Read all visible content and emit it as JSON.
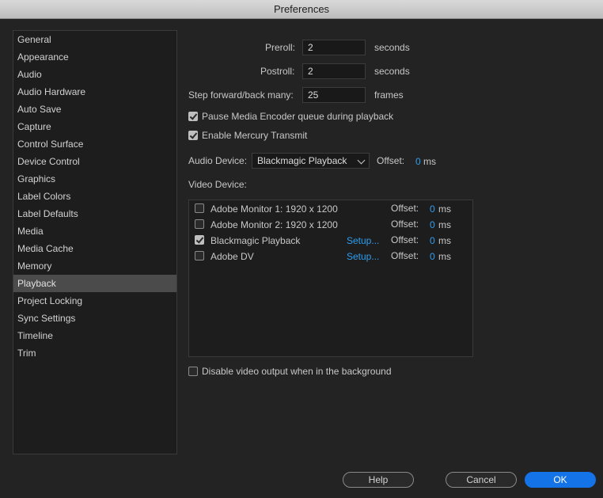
{
  "window": {
    "title": "Preferences"
  },
  "sidebar": {
    "items": [
      {
        "label": "General"
      },
      {
        "label": "Appearance"
      },
      {
        "label": "Audio"
      },
      {
        "label": "Audio Hardware"
      },
      {
        "label": "Auto Save"
      },
      {
        "label": "Capture"
      },
      {
        "label": "Control Surface"
      },
      {
        "label": "Device Control"
      },
      {
        "label": "Graphics"
      },
      {
        "label": "Label Colors"
      },
      {
        "label": "Label Defaults"
      },
      {
        "label": "Media"
      },
      {
        "label": "Media Cache"
      },
      {
        "label": "Memory"
      },
      {
        "label": "Playback"
      },
      {
        "label": "Project Locking"
      },
      {
        "label": "Sync Settings"
      },
      {
        "label": "Timeline"
      },
      {
        "label": "Trim"
      }
    ],
    "selected": "Playback"
  },
  "playback": {
    "preroll": {
      "label": "Preroll:",
      "value": "2",
      "unit": "seconds"
    },
    "postroll": {
      "label": "Postroll:",
      "value": "2",
      "unit": "seconds"
    },
    "step": {
      "label": "Step forward/back many:",
      "value": "25",
      "unit": "frames"
    },
    "pause_encoder": {
      "label": "Pause Media Encoder queue during playback",
      "checked": true
    },
    "mercury": {
      "label": "Enable Mercury Transmit",
      "checked": true
    },
    "audio_device": {
      "label": "Audio Device:",
      "value": "Blackmagic Playback",
      "offset_label": "Offset:",
      "offset_value": "0",
      "offset_unit": "ms"
    },
    "video_device_label": "Video Device:",
    "video_devices": [
      {
        "name": "Adobe Monitor 1: 1920 x 1200",
        "checked": false,
        "setup": "",
        "offset_label": "Offset:",
        "offset_value": "0",
        "offset_unit": "ms"
      },
      {
        "name": "Adobe Monitor 2: 1920 x 1200",
        "checked": false,
        "setup": "",
        "offset_label": "Offset:",
        "offset_value": "0",
        "offset_unit": "ms"
      },
      {
        "name": "Blackmagic Playback",
        "checked": true,
        "setup": "Setup...",
        "offset_label": "Offset:",
        "offset_value": "0",
        "offset_unit": "ms"
      },
      {
        "name": "Adobe DV",
        "checked": false,
        "setup": "Setup...",
        "offset_label": "Offset:",
        "offset_value": "0",
        "offset_unit": "ms"
      }
    ],
    "disable_video_bg": {
      "label": "Disable video output when in the background",
      "checked": false
    }
  },
  "buttons": {
    "help": "Help",
    "cancel": "Cancel",
    "ok": "OK"
  }
}
